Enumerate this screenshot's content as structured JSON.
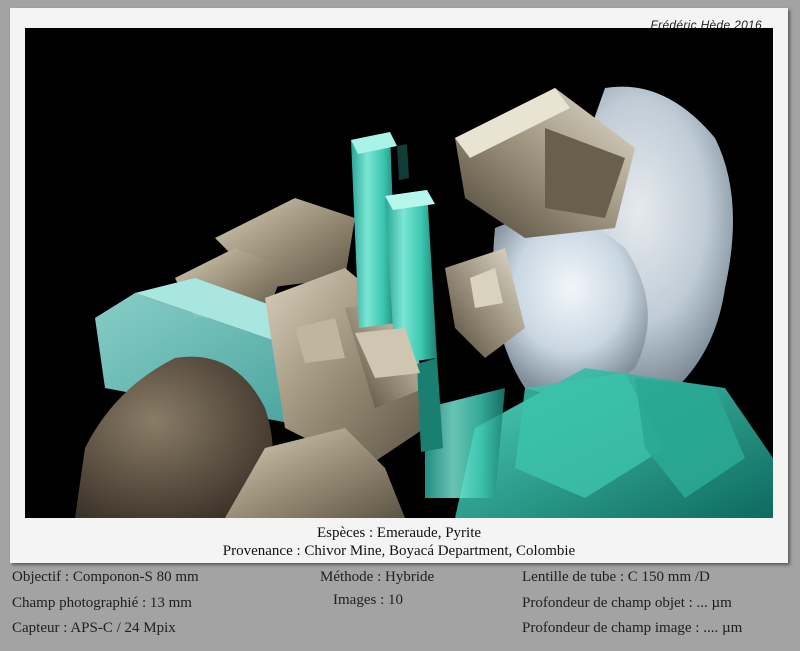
{
  "credit": "Frédéric Hède 2016",
  "photo_subject": "emerald-and-pyrite-specimen",
  "caption": {
    "species": "Espèces : Emeraude, Pyrite",
    "locality": "Provenance : Chivor Mine, Boyacá Department, Colombie"
  },
  "meta": {
    "objective": "Objectif : Componon-S 80 mm",
    "field": "Champ photographié : 13 mm",
    "sensor": "Capteur : APS-C / 24 Mpix",
    "method": "Méthode : Hybride",
    "images": "Images : 10",
    "tube_lens": "Lentille de tube : C 150 mm /D",
    "depth_object": "Profondeur de champ objet : ... µm",
    "depth_image": "Profondeur de champ image : .... µm"
  },
  "colors": {
    "background": "#a3a3a3",
    "frame": "#f4f4f4",
    "photo_bg": "#000000",
    "emerald": "#3fc9b0",
    "pyrite": "#a89c86",
    "calcite": "#d8e6ee"
  }
}
